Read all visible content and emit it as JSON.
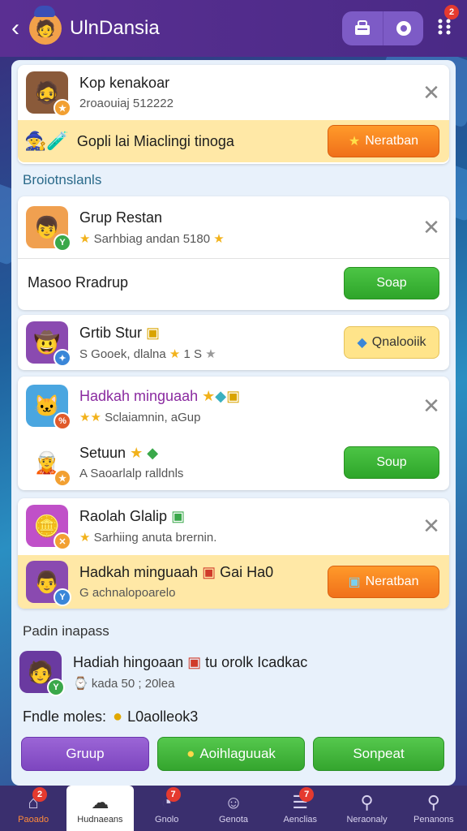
{
  "app": {
    "title": "UlnDansia",
    "header_badge": "2"
  },
  "top_card": {
    "title": "Kop kenakoar",
    "subtitle": "2roaouiaj 512222",
    "promo_text": "Gopli lai Miaclingi tinoga",
    "promo_button": "Neratban"
  },
  "section1_label": "Broiotnslanls",
  "card2": {
    "title": "Grup Restan",
    "subtitle": "Sarhbiag andan 5180",
    "input_value": "Masoo Rradrup",
    "button": "Soap"
  },
  "card3": {
    "title": "Grtib Stur",
    "subtitle": "S Gooek, dlalna",
    "rating_text": "1 S",
    "button": "Qnalooiik"
  },
  "card4": {
    "row1_title": "Hadkah minguaah",
    "row1_subtitle": "Sclaiamnin, aGup",
    "row2_title": "Setuun",
    "row2_subtitle": "A Saoarlalp ralldnls",
    "button": "Soup"
  },
  "card5": {
    "row1_title": "Raolah Glalip",
    "row1_subtitle": "Sarhiing anuta brernin.",
    "row2_title": "Hadkah minguaah",
    "row2_title_extra": "Gai  Ha0",
    "row2_subtitle": "G achnalopoarelo",
    "button": "Neratban"
  },
  "section2_label": "Padin inapass",
  "card6": {
    "title": "Hadiah hingoaan",
    "title_extra": "tu  orolk  Icadkac",
    "subtitle": "kada 50 ; 20lea"
  },
  "footer_label": "Fndle moles:",
  "footer_value": "L0aolleok3",
  "actions": {
    "btn1": "Gruup",
    "btn2": "Aoihlaguuak",
    "btn3": "Sonpeat"
  },
  "nav": [
    {
      "label": "Paoado",
      "icon": "home-icon",
      "badge": "2"
    },
    {
      "label": "Hudnaeans",
      "icon": "groups-icon",
      "badge": ""
    },
    {
      "label": "Gnolo",
      "icon": "chat-icon",
      "badge": "7"
    },
    {
      "label": "Genota",
      "icon": "profile-icon",
      "badge": ""
    },
    {
      "label": "Aenclias",
      "icon": "list-icon",
      "badge": "7"
    },
    {
      "label": "Neraonaly",
      "icon": "search-icon",
      "badge": ""
    },
    {
      "label": "Penanons",
      "icon": "search-icon",
      "badge": ""
    }
  ],
  "colors": {
    "header": "#5a2f92",
    "accent_orange": "#f0701a",
    "accent_green": "#2ea52a",
    "highlight": "#ffe8a6",
    "nav_bg": "#3a2f6e"
  }
}
